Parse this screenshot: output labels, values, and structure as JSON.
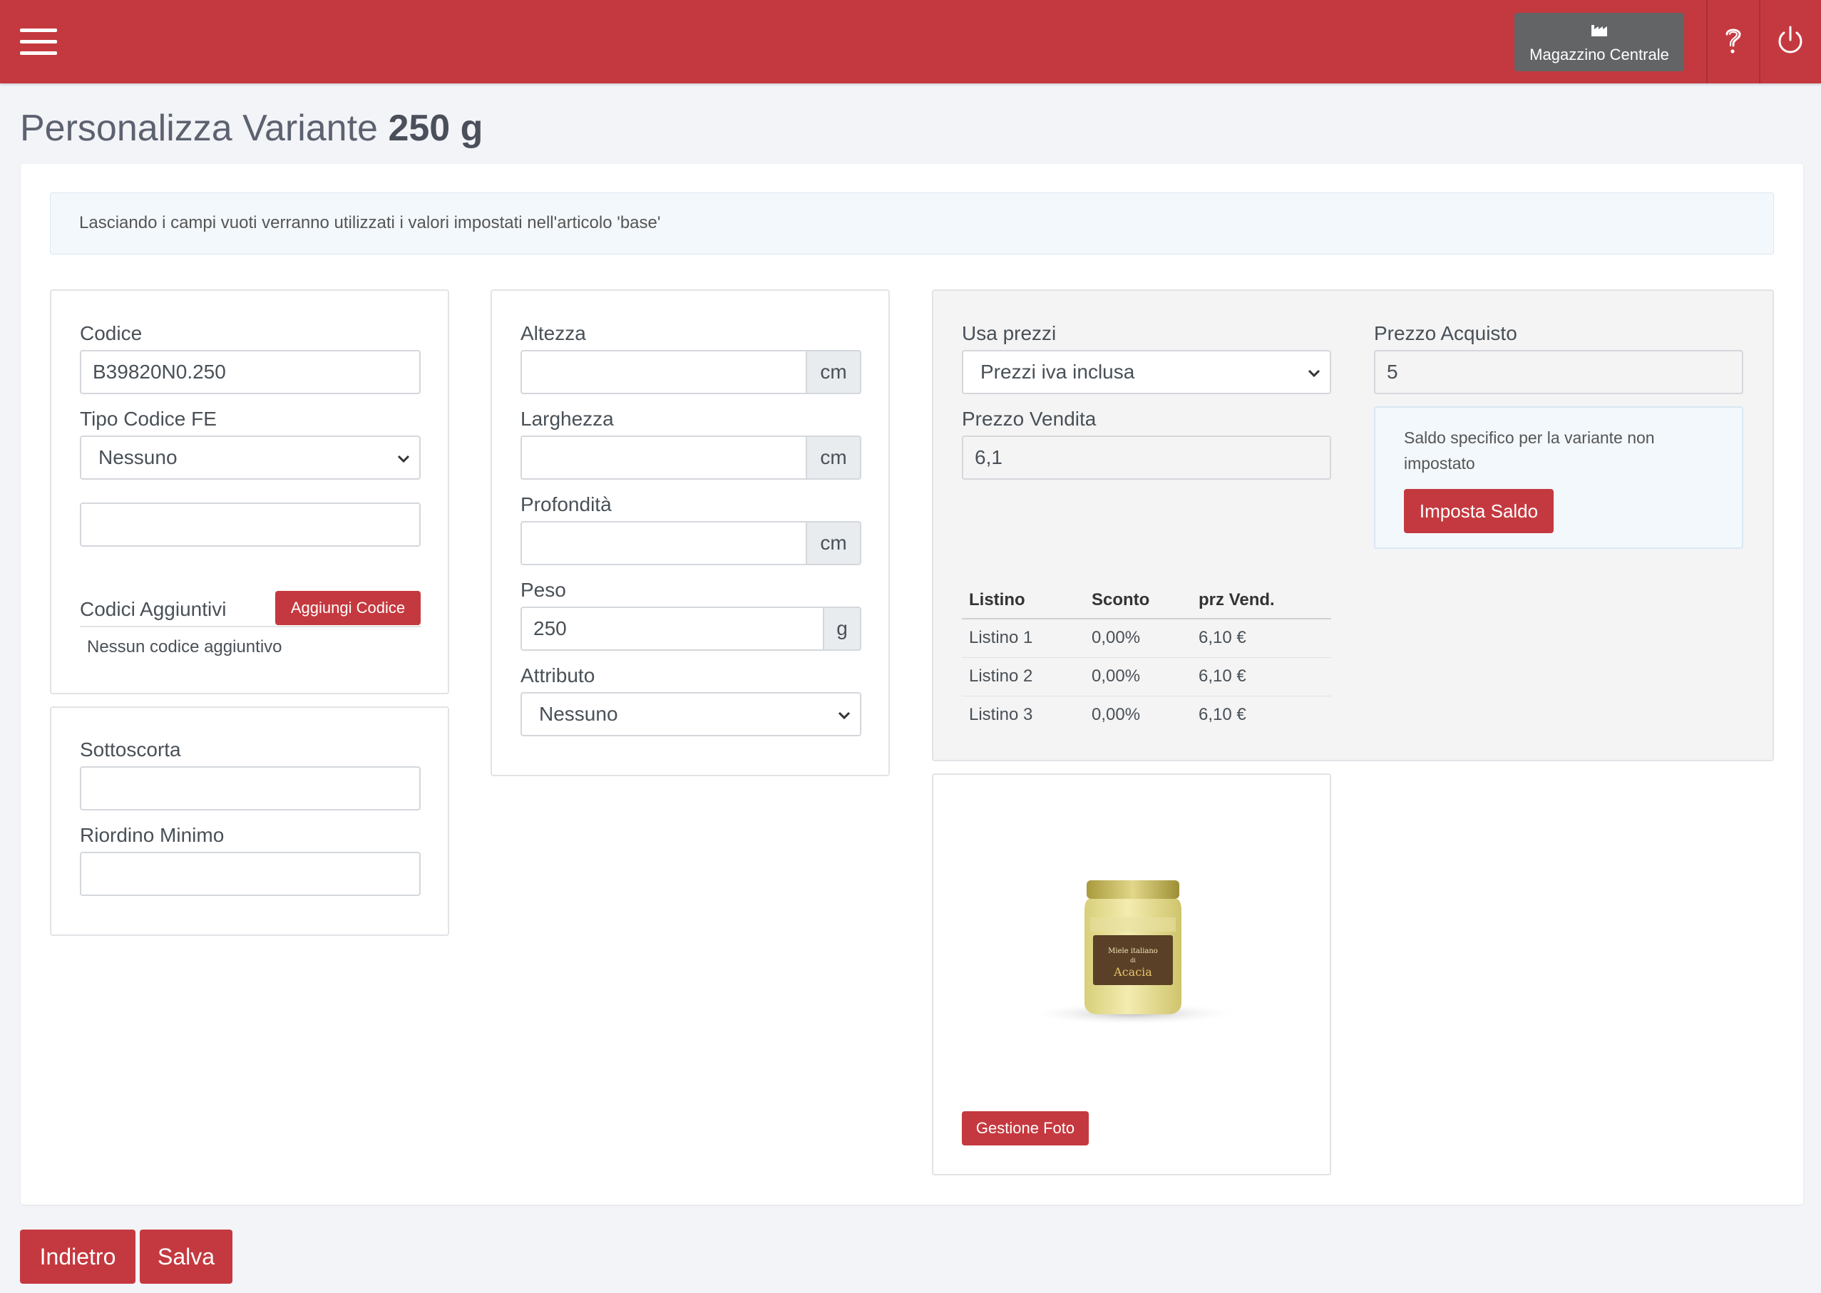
{
  "header": {
    "warehouse_label": "Magazzino Centrale",
    "menu_icon": "hamburger-menu-icon",
    "help_icon": "question-mark-icon",
    "power_icon": "power-icon",
    "brand_color": "#c4393f"
  },
  "title": {
    "prefix": "Personalizza Variante",
    "variant": "250 g"
  },
  "info_message": "Lasciando i campi vuoti verranno utilizzati i valori impostati nell'articolo 'base'",
  "codes": {
    "codice_label": "Codice",
    "codice_value": "B39820N0.250",
    "tipo_codice_label": "Tipo Codice FE",
    "tipo_codice_value": "Nessuno",
    "extra_value": "",
    "codici_aggiuntivi_label": "Codici Aggiuntivi",
    "aggiungi_codice_button": "Aggiungi Codice",
    "nessun_codice_text": "Nessun codice aggiuntivo"
  },
  "stock": {
    "sottoscorta_label": "Sottoscorta",
    "sottoscorta_value": "",
    "riordino_label": "Riordino Minimo",
    "riordino_value": ""
  },
  "dimensions": {
    "altezza_label": "Altezza",
    "altezza_value": "",
    "altezza_unit": "cm",
    "larghezza_label": "Larghezza",
    "larghezza_value": "",
    "larghezza_unit": "cm",
    "profondita_label": "Profondità",
    "profondita_value": "",
    "profondita_unit": "cm",
    "peso_label": "Peso",
    "peso_value": "250",
    "peso_unit": "g",
    "attributo_label": "Attributo",
    "attributo_value": "Nessuno"
  },
  "prices": {
    "usa_prezzi_label": "Usa prezzi",
    "usa_prezzi_value": "Prezzi iva inclusa",
    "prezzo_vendita_label": "Prezzo Vendita",
    "prezzo_vendita_value": "6,1",
    "prezzo_acquisto_label": "Prezzo Acquisto",
    "prezzo_acquisto_value": "5",
    "saldo_message": "Saldo specifico per la variante non impostato",
    "imposta_saldo_button": "Imposta Saldo",
    "table": {
      "headers": [
        "Listino",
        "Sconto",
        "prz Vend."
      ],
      "rows": [
        [
          "Listino 1",
          "0,00%",
          "6,10 €"
        ],
        [
          "Listino 2",
          "0,00%",
          "6,10 €"
        ],
        [
          "Listino 3",
          "0,00%",
          "6,10 €"
        ]
      ]
    }
  },
  "photo": {
    "jar_label_line1": "Miele italiano",
    "jar_label_line2": "di",
    "jar_label_line3": "Acacia",
    "gestione_foto_button": "Gestione Foto"
  },
  "footer": {
    "indietro_button": "Indietro",
    "salva_button": "Salva"
  }
}
